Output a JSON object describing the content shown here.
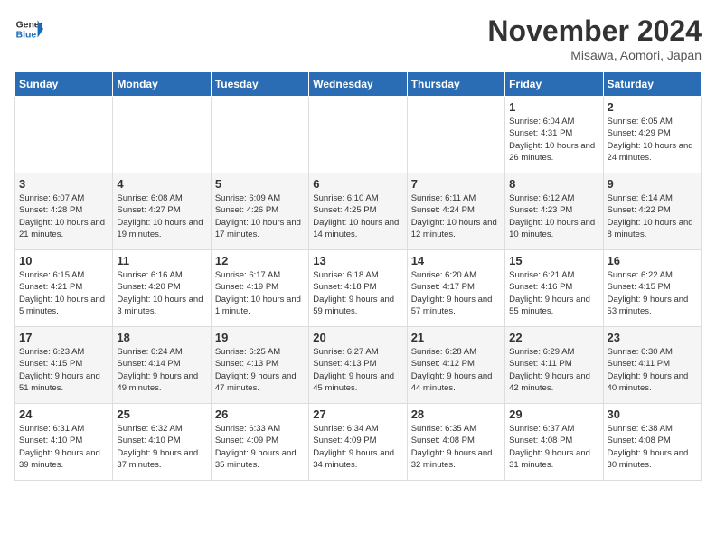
{
  "header": {
    "logo_general": "General",
    "logo_blue": "Blue",
    "title": "November 2024",
    "subtitle": "Misawa, Aomori, Japan"
  },
  "weekdays": [
    "Sunday",
    "Monday",
    "Tuesday",
    "Wednesday",
    "Thursday",
    "Friday",
    "Saturday"
  ],
  "weeks": [
    [
      {
        "day": "",
        "info": ""
      },
      {
        "day": "",
        "info": ""
      },
      {
        "day": "",
        "info": ""
      },
      {
        "day": "",
        "info": ""
      },
      {
        "day": "",
        "info": ""
      },
      {
        "day": "1",
        "info": "Sunrise: 6:04 AM\nSunset: 4:31 PM\nDaylight: 10 hours and 26 minutes."
      },
      {
        "day": "2",
        "info": "Sunrise: 6:05 AM\nSunset: 4:29 PM\nDaylight: 10 hours and 24 minutes."
      }
    ],
    [
      {
        "day": "3",
        "info": "Sunrise: 6:07 AM\nSunset: 4:28 PM\nDaylight: 10 hours and 21 minutes."
      },
      {
        "day": "4",
        "info": "Sunrise: 6:08 AM\nSunset: 4:27 PM\nDaylight: 10 hours and 19 minutes."
      },
      {
        "day": "5",
        "info": "Sunrise: 6:09 AM\nSunset: 4:26 PM\nDaylight: 10 hours and 17 minutes."
      },
      {
        "day": "6",
        "info": "Sunrise: 6:10 AM\nSunset: 4:25 PM\nDaylight: 10 hours and 14 minutes."
      },
      {
        "day": "7",
        "info": "Sunrise: 6:11 AM\nSunset: 4:24 PM\nDaylight: 10 hours and 12 minutes."
      },
      {
        "day": "8",
        "info": "Sunrise: 6:12 AM\nSunset: 4:23 PM\nDaylight: 10 hours and 10 minutes."
      },
      {
        "day": "9",
        "info": "Sunrise: 6:14 AM\nSunset: 4:22 PM\nDaylight: 10 hours and 8 minutes."
      }
    ],
    [
      {
        "day": "10",
        "info": "Sunrise: 6:15 AM\nSunset: 4:21 PM\nDaylight: 10 hours and 5 minutes."
      },
      {
        "day": "11",
        "info": "Sunrise: 6:16 AM\nSunset: 4:20 PM\nDaylight: 10 hours and 3 minutes."
      },
      {
        "day": "12",
        "info": "Sunrise: 6:17 AM\nSunset: 4:19 PM\nDaylight: 10 hours and 1 minute."
      },
      {
        "day": "13",
        "info": "Sunrise: 6:18 AM\nSunset: 4:18 PM\nDaylight: 9 hours and 59 minutes."
      },
      {
        "day": "14",
        "info": "Sunrise: 6:20 AM\nSunset: 4:17 PM\nDaylight: 9 hours and 57 minutes."
      },
      {
        "day": "15",
        "info": "Sunrise: 6:21 AM\nSunset: 4:16 PM\nDaylight: 9 hours and 55 minutes."
      },
      {
        "day": "16",
        "info": "Sunrise: 6:22 AM\nSunset: 4:15 PM\nDaylight: 9 hours and 53 minutes."
      }
    ],
    [
      {
        "day": "17",
        "info": "Sunrise: 6:23 AM\nSunset: 4:15 PM\nDaylight: 9 hours and 51 minutes."
      },
      {
        "day": "18",
        "info": "Sunrise: 6:24 AM\nSunset: 4:14 PM\nDaylight: 9 hours and 49 minutes."
      },
      {
        "day": "19",
        "info": "Sunrise: 6:25 AM\nSunset: 4:13 PM\nDaylight: 9 hours and 47 minutes."
      },
      {
        "day": "20",
        "info": "Sunrise: 6:27 AM\nSunset: 4:13 PM\nDaylight: 9 hours and 45 minutes."
      },
      {
        "day": "21",
        "info": "Sunrise: 6:28 AM\nSunset: 4:12 PM\nDaylight: 9 hours and 44 minutes."
      },
      {
        "day": "22",
        "info": "Sunrise: 6:29 AM\nSunset: 4:11 PM\nDaylight: 9 hours and 42 minutes."
      },
      {
        "day": "23",
        "info": "Sunrise: 6:30 AM\nSunset: 4:11 PM\nDaylight: 9 hours and 40 minutes."
      }
    ],
    [
      {
        "day": "24",
        "info": "Sunrise: 6:31 AM\nSunset: 4:10 PM\nDaylight: 9 hours and 39 minutes."
      },
      {
        "day": "25",
        "info": "Sunrise: 6:32 AM\nSunset: 4:10 PM\nDaylight: 9 hours and 37 minutes."
      },
      {
        "day": "26",
        "info": "Sunrise: 6:33 AM\nSunset: 4:09 PM\nDaylight: 9 hours and 35 minutes."
      },
      {
        "day": "27",
        "info": "Sunrise: 6:34 AM\nSunset: 4:09 PM\nDaylight: 9 hours and 34 minutes."
      },
      {
        "day": "28",
        "info": "Sunrise: 6:35 AM\nSunset: 4:08 PM\nDaylight: 9 hours and 32 minutes."
      },
      {
        "day": "29",
        "info": "Sunrise: 6:37 AM\nSunset: 4:08 PM\nDaylight: 9 hours and 31 minutes."
      },
      {
        "day": "30",
        "info": "Sunrise: 6:38 AM\nSunset: 4:08 PM\nDaylight: 9 hours and 30 minutes."
      }
    ]
  ]
}
